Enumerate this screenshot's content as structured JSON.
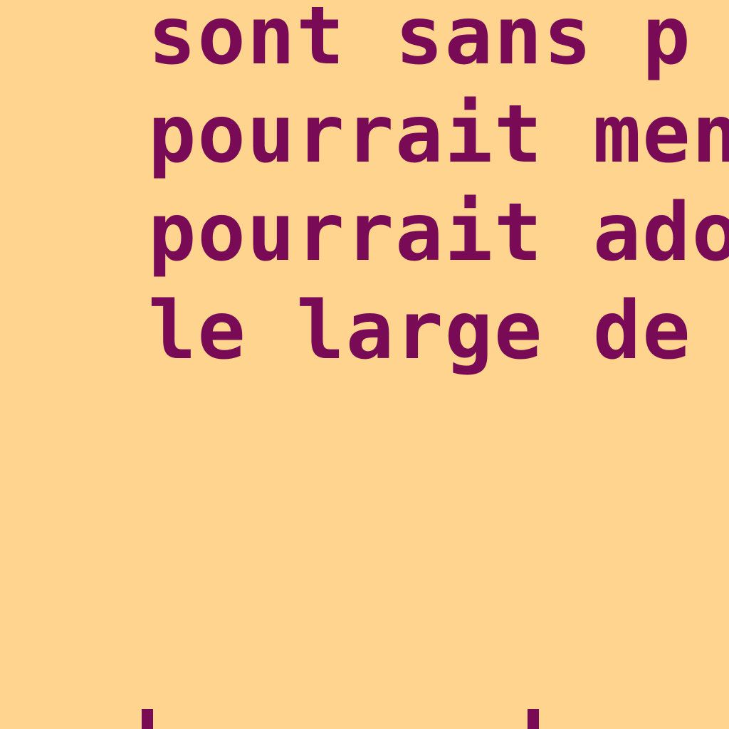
{
  "document": {
    "lines": [
      "sont sans p",
      "pourrait mene",
      "pourrait adop",
      "le large de c"
    ]
  },
  "colors": {
    "background": "#ffd48e",
    "text": "#790a55"
  }
}
